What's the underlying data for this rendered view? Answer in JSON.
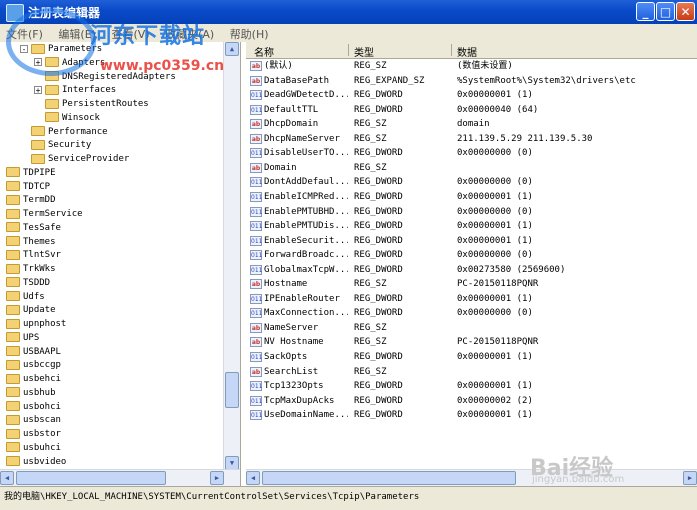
{
  "window": {
    "title": "注册表编辑器",
    "minimize_label": "_",
    "maximize_label": "□",
    "close_label": "✕"
  },
  "menu": [
    "文件(F)",
    "编辑(E)",
    "查看(V)",
    "收藏夹(A)",
    "帮助(H)"
  ],
  "tree": [
    {
      "label": "Parameters",
      "indent": 1,
      "expander": "-"
    },
    {
      "label": "Adapters",
      "indent": 2,
      "expander": "+"
    },
    {
      "label": "DNSRegisteredAdapters",
      "indent": 2,
      "expander": ""
    },
    {
      "label": "Interfaces",
      "indent": 2,
      "expander": "+"
    },
    {
      "label": "PersistentRoutes",
      "indent": 2,
      "expander": ""
    },
    {
      "label": "Winsock",
      "indent": 2,
      "expander": ""
    },
    {
      "label": "Performance",
      "indent": 1,
      "expander": ""
    },
    {
      "label": "Security",
      "indent": 1,
      "expander": ""
    },
    {
      "label": "ServiceProvider",
      "indent": 1,
      "expander": ""
    },
    {
      "label": "TDPIPE",
      "indent": 0,
      "expander": ""
    },
    {
      "label": "TDTCP",
      "indent": 0,
      "expander": ""
    },
    {
      "label": "TermDD",
      "indent": 0,
      "expander": ""
    },
    {
      "label": "TermService",
      "indent": 0,
      "expander": ""
    },
    {
      "label": "TesSafe",
      "indent": 0,
      "expander": ""
    },
    {
      "label": "Themes",
      "indent": 0,
      "expander": ""
    },
    {
      "label": "TlntSvr",
      "indent": 0,
      "expander": ""
    },
    {
      "label": "TrkWks",
      "indent": 0,
      "expander": ""
    },
    {
      "label": "TSDDD",
      "indent": 0,
      "expander": ""
    },
    {
      "label": "Udfs",
      "indent": 0,
      "expander": ""
    },
    {
      "label": "Update",
      "indent": 0,
      "expander": ""
    },
    {
      "label": "upnphost",
      "indent": 0,
      "expander": ""
    },
    {
      "label": "UPS",
      "indent": 0,
      "expander": ""
    },
    {
      "label": "USBAAPL",
      "indent": 0,
      "expander": ""
    },
    {
      "label": "usbccgp",
      "indent": 0,
      "expander": ""
    },
    {
      "label": "usbehci",
      "indent": 0,
      "expander": ""
    },
    {
      "label": "usbhub",
      "indent": 0,
      "expander": ""
    },
    {
      "label": "usbohci",
      "indent": 0,
      "expander": ""
    },
    {
      "label": "usbscan",
      "indent": 0,
      "expander": ""
    },
    {
      "label": "usbstor",
      "indent": 0,
      "expander": ""
    },
    {
      "label": "usbuhci",
      "indent": 0,
      "expander": ""
    },
    {
      "label": "usbvideo",
      "indent": 0,
      "expander": ""
    }
  ],
  "columns": {
    "name": "名称",
    "type": "类型",
    "data": "数据"
  },
  "values": [
    {
      "icon": "ab",
      "name": "(默认)",
      "type": "REG_SZ",
      "data": "(数值未设置)"
    },
    {
      "icon": "ab",
      "name": "DataBasePath",
      "type": "REG_EXPAND_SZ",
      "data": "%SystemRoot%\\System32\\drivers\\etc"
    },
    {
      "icon": "dw",
      "name": "DeadGWDetectD...",
      "type": "REG_DWORD",
      "data": "0x00000001 (1)"
    },
    {
      "icon": "dw",
      "name": "DefaultTTL",
      "type": "REG_DWORD",
      "data": "0x00000040 (64)"
    },
    {
      "icon": "ab",
      "name": "DhcpDomain",
      "type": "REG_SZ",
      "data": "domain"
    },
    {
      "icon": "ab",
      "name": "DhcpNameServer",
      "type": "REG_SZ",
      "data": "211.139.5.29 211.139.5.30"
    },
    {
      "icon": "dw",
      "name": "DisableUserTO...",
      "type": "REG_DWORD",
      "data": "0x00000000 (0)"
    },
    {
      "icon": "ab",
      "name": "Domain",
      "type": "REG_SZ",
      "data": ""
    },
    {
      "icon": "dw",
      "name": "DontAddDefaul...",
      "type": "REG_DWORD",
      "data": "0x00000000 (0)"
    },
    {
      "icon": "dw",
      "name": "EnableICMPRed...",
      "type": "REG_DWORD",
      "data": "0x00000001 (1)"
    },
    {
      "icon": "dw",
      "name": "EnablePMTUBHD...",
      "type": "REG_DWORD",
      "data": "0x00000000 (0)"
    },
    {
      "icon": "dw",
      "name": "EnablePMTUDis...",
      "type": "REG_DWORD",
      "data": "0x00000001 (1)"
    },
    {
      "icon": "dw",
      "name": "EnableSecurit...",
      "type": "REG_DWORD",
      "data": "0x00000001 (1)"
    },
    {
      "icon": "dw",
      "name": "ForwardBroadc...",
      "type": "REG_DWORD",
      "data": "0x00000000 (0)"
    },
    {
      "icon": "dw",
      "name": "GlobalmaxTcpW...",
      "type": "REG_DWORD",
      "data": "0x00273580 (2569600)"
    },
    {
      "icon": "ab",
      "name": "Hostname",
      "type": "REG_SZ",
      "data": "PC-20150118PQNR"
    },
    {
      "icon": "dw",
      "name": "IPEnableRouter",
      "type": "REG_DWORD",
      "data": "0x00000001 (1)"
    },
    {
      "icon": "dw",
      "name": "MaxConnection...",
      "type": "REG_DWORD",
      "data": "0x00000000 (0)"
    },
    {
      "icon": "ab",
      "name": "NameServer",
      "type": "REG_SZ",
      "data": ""
    },
    {
      "icon": "ab",
      "name": "NV Hostname",
      "type": "REG_SZ",
      "data": "PC-20150118PQNR"
    },
    {
      "icon": "dw",
      "name": "SackOpts",
      "type": "REG_DWORD",
      "data": "0x00000001 (1)"
    },
    {
      "icon": "ab",
      "name": "SearchList",
      "type": "REG_SZ",
      "data": ""
    },
    {
      "icon": "dw",
      "name": "Tcp1323Opts",
      "type": "REG_DWORD",
      "data": "0x00000001 (1)"
    },
    {
      "icon": "dw",
      "name": "TcpMaxDupAcks",
      "type": "REG_DWORD",
      "data": "0x00000002 (2)"
    },
    {
      "icon": "dw",
      "name": "UseDomainName...",
      "type": "REG_DWORD",
      "data": "0x00000001 (1)"
    }
  ],
  "status_path": "我的电脑\\HKEY_LOCAL_MACHINE\\SYSTEM\\CurrentControlSet\\Services\\Tcpip\\Parameters",
  "watermarks": {
    "site": "河东下载站",
    "url": "www.pc0359.cn",
    "baidu": "Bai经验",
    "baidu_url": "jingyan.baidu.com"
  }
}
